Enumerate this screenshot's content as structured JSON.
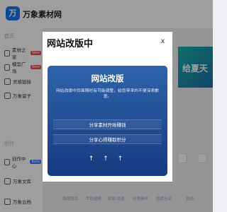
{
  "app": {
    "logo_text": "万",
    "brand": "万象素材网"
  },
  "sidebar": {
    "section_home": "首页",
    "section_create": "创作",
    "items": [
      {
        "label": "素材之家",
        "badge": "New",
        "icon": "image-icon"
      },
      {
        "label": "模型广场",
        "badge": "New",
        "icon": "cube-icon"
      },
      {
        "label": "灵感链接",
        "badge": "",
        "icon": "bulb-icon"
      },
      {
        "label": "万象留子",
        "badge": "",
        "icon": "flag-icon"
      },
      {
        "label": "创作中心",
        "badge": "Beta",
        "icon": "pen-icon"
      },
      {
        "label": "万象文库",
        "badge": "",
        "icon": "book-icon"
      },
      {
        "label": "万象云档",
        "badge": "",
        "icon": "cloud-icon"
      }
    ]
  },
  "background": {
    "banner_text": "给夏天",
    "shortcuts": [
      "海报图库",
      "手机壁纸",
      "封面·背景",
      "创意素材",
      "图库分享",
      "其他"
    ]
  },
  "modal": {
    "title": "网站改版中",
    "close": "x",
    "card_title": "网站改版",
    "card_desc": "网站改版中页面随时有可能调整，给您带来的不便深表歉意。",
    "buttons": [
      "分享素材开始赚钱",
      "分享心得赚取积分"
    ],
    "arrows": "↑ ↑ ↑"
  }
}
